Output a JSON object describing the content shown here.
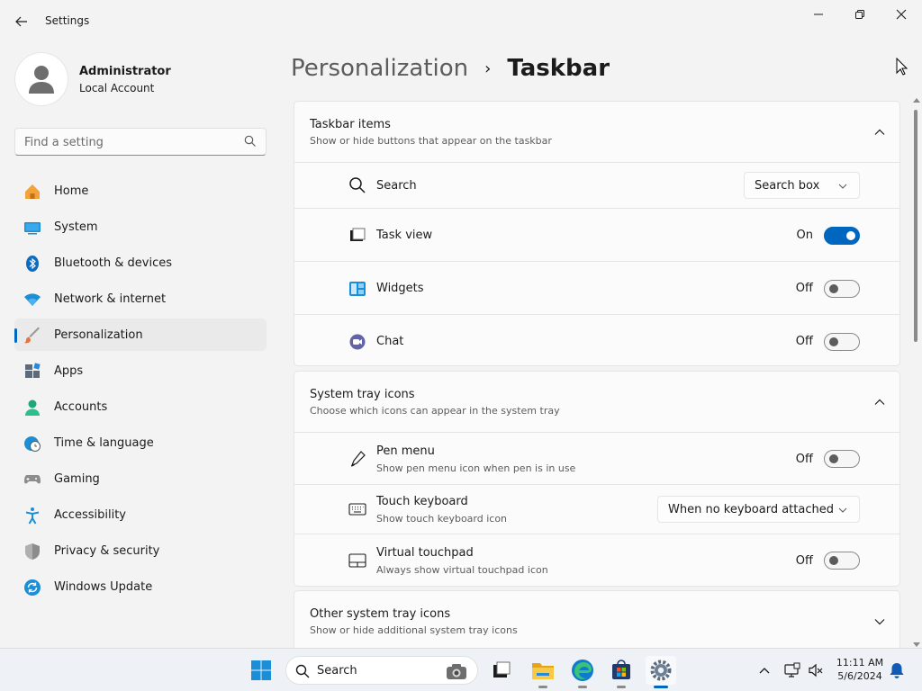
{
  "window": {
    "title": "Settings"
  },
  "profile": {
    "name": "Administrator",
    "account_type": "Local Account"
  },
  "search": {
    "placeholder": "Find a setting"
  },
  "sidebar": {
    "items": [
      {
        "label": "Home",
        "icon": "home-icon"
      },
      {
        "label": "System",
        "icon": "monitor-icon"
      },
      {
        "label": "Bluetooth & devices",
        "icon": "bluetooth-icon"
      },
      {
        "label": "Network & internet",
        "icon": "wifi-icon"
      },
      {
        "label": "Personalization",
        "icon": "paintbrush-icon",
        "selected": true
      },
      {
        "label": "Apps",
        "icon": "apps-icon"
      },
      {
        "label": "Accounts",
        "icon": "person-icon"
      },
      {
        "label": "Time & language",
        "icon": "globe-clock-icon"
      },
      {
        "label": "Gaming",
        "icon": "gamepad-icon"
      },
      {
        "label": "Accessibility",
        "icon": "accessibility-icon"
      },
      {
        "label": "Privacy & security",
        "icon": "shield-icon"
      },
      {
        "label": "Windows Update",
        "icon": "update-icon"
      }
    ]
  },
  "breadcrumb": {
    "parent": "Personalization",
    "separator": "›",
    "current": "Taskbar"
  },
  "sections": {
    "taskbar_items": {
      "title": "Taskbar items",
      "subtitle": "Show or hide buttons that appear on the taskbar",
      "expanded": true,
      "rows": {
        "search": {
          "label": "Search",
          "value": "Search box",
          "icon": "search-icon"
        },
        "task_view": {
          "label": "Task view",
          "state": "On",
          "on": true,
          "icon": "task-view-icon"
        },
        "widgets": {
          "label": "Widgets",
          "state": "Off",
          "on": false,
          "icon": "widgets-icon"
        },
        "chat": {
          "label": "Chat",
          "state": "Off",
          "on": false,
          "icon": "chat-icon"
        }
      }
    },
    "system_tray": {
      "title": "System tray icons",
      "subtitle": "Choose which icons can appear in the system tray",
      "expanded": true,
      "rows": {
        "pen_menu": {
          "label": "Pen menu",
          "description": "Show pen menu icon when pen is in use",
          "state": "Off",
          "on": false,
          "icon": "pen-icon"
        },
        "touch_keyboard": {
          "label": "Touch keyboard",
          "description": "Show touch keyboard icon",
          "value": "When no keyboard attached",
          "icon": "keyboard-icon"
        },
        "virtual_touchpad": {
          "label": "Virtual touchpad",
          "description": "Always show virtual touchpad icon",
          "state": "Off",
          "on": false,
          "icon": "touchpad-icon"
        }
      }
    },
    "other_tray": {
      "title": "Other system tray icons",
      "subtitle": "Show or hide additional system tray icons",
      "expanded": false
    }
  },
  "taskbar": {
    "search_label": "Search",
    "time": "11:11 AM",
    "date": "5/6/2024"
  },
  "colors": {
    "accent": "#0067c0",
    "background": "#f3f3f3",
    "card": "#fbfbfb"
  }
}
